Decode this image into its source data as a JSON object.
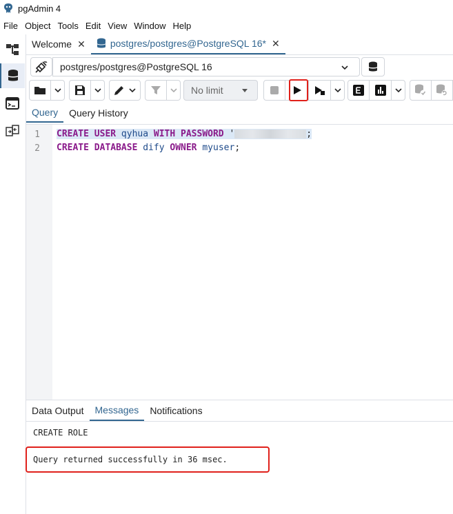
{
  "window": {
    "title": "pgAdmin 4"
  },
  "menu": [
    "File",
    "Object",
    "Tools",
    "Edit",
    "View",
    "Window",
    "Help"
  ],
  "tabs": [
    {
      "label": "Welcome",
      "close": "✕"
    },
    {
      "label": "postgres/postgres@PostgreSQL 16*",
      "close": "✕"
    }
  ],
  "connection": {
    "value": "postgres/postgres@PostgreSQL 16"
  },
  "toolbar": {
    "limit_value": "No limit"
  },
  "editor_tabs": [
    "Query",
    "Query History"
  ],
  "editor": {
    "line_numbers": [
      "1",
      "2"
    ],
    "line1": {
      "kw1": "CREATE USER",
      "id1": "qyhua",
      "kw2": "WITH PASSWORD",
      "quote": "'",
      "end": ";"
    },
    "line2": {
      "kw1": "CREATE DATABASE",
      "id1": "dify",
      "kw2": "OWNER",
      "id2": "myuser",
      "end": ";"
    }
  },
  "result_tabs": [
    "Data Output",
    "Messages",
    "Notifications"
  ],
  "messages": {
    "line1": "CREATE ROLE",
    "line2": "Query returned successfully in 36 msec."
  },
  "colors": {
    "accent": "#326690",
    "highlight": "#e0201a",
    "keyword": "#8a1a8a",
    "identifier": "#1e4a8a"
  }
}
